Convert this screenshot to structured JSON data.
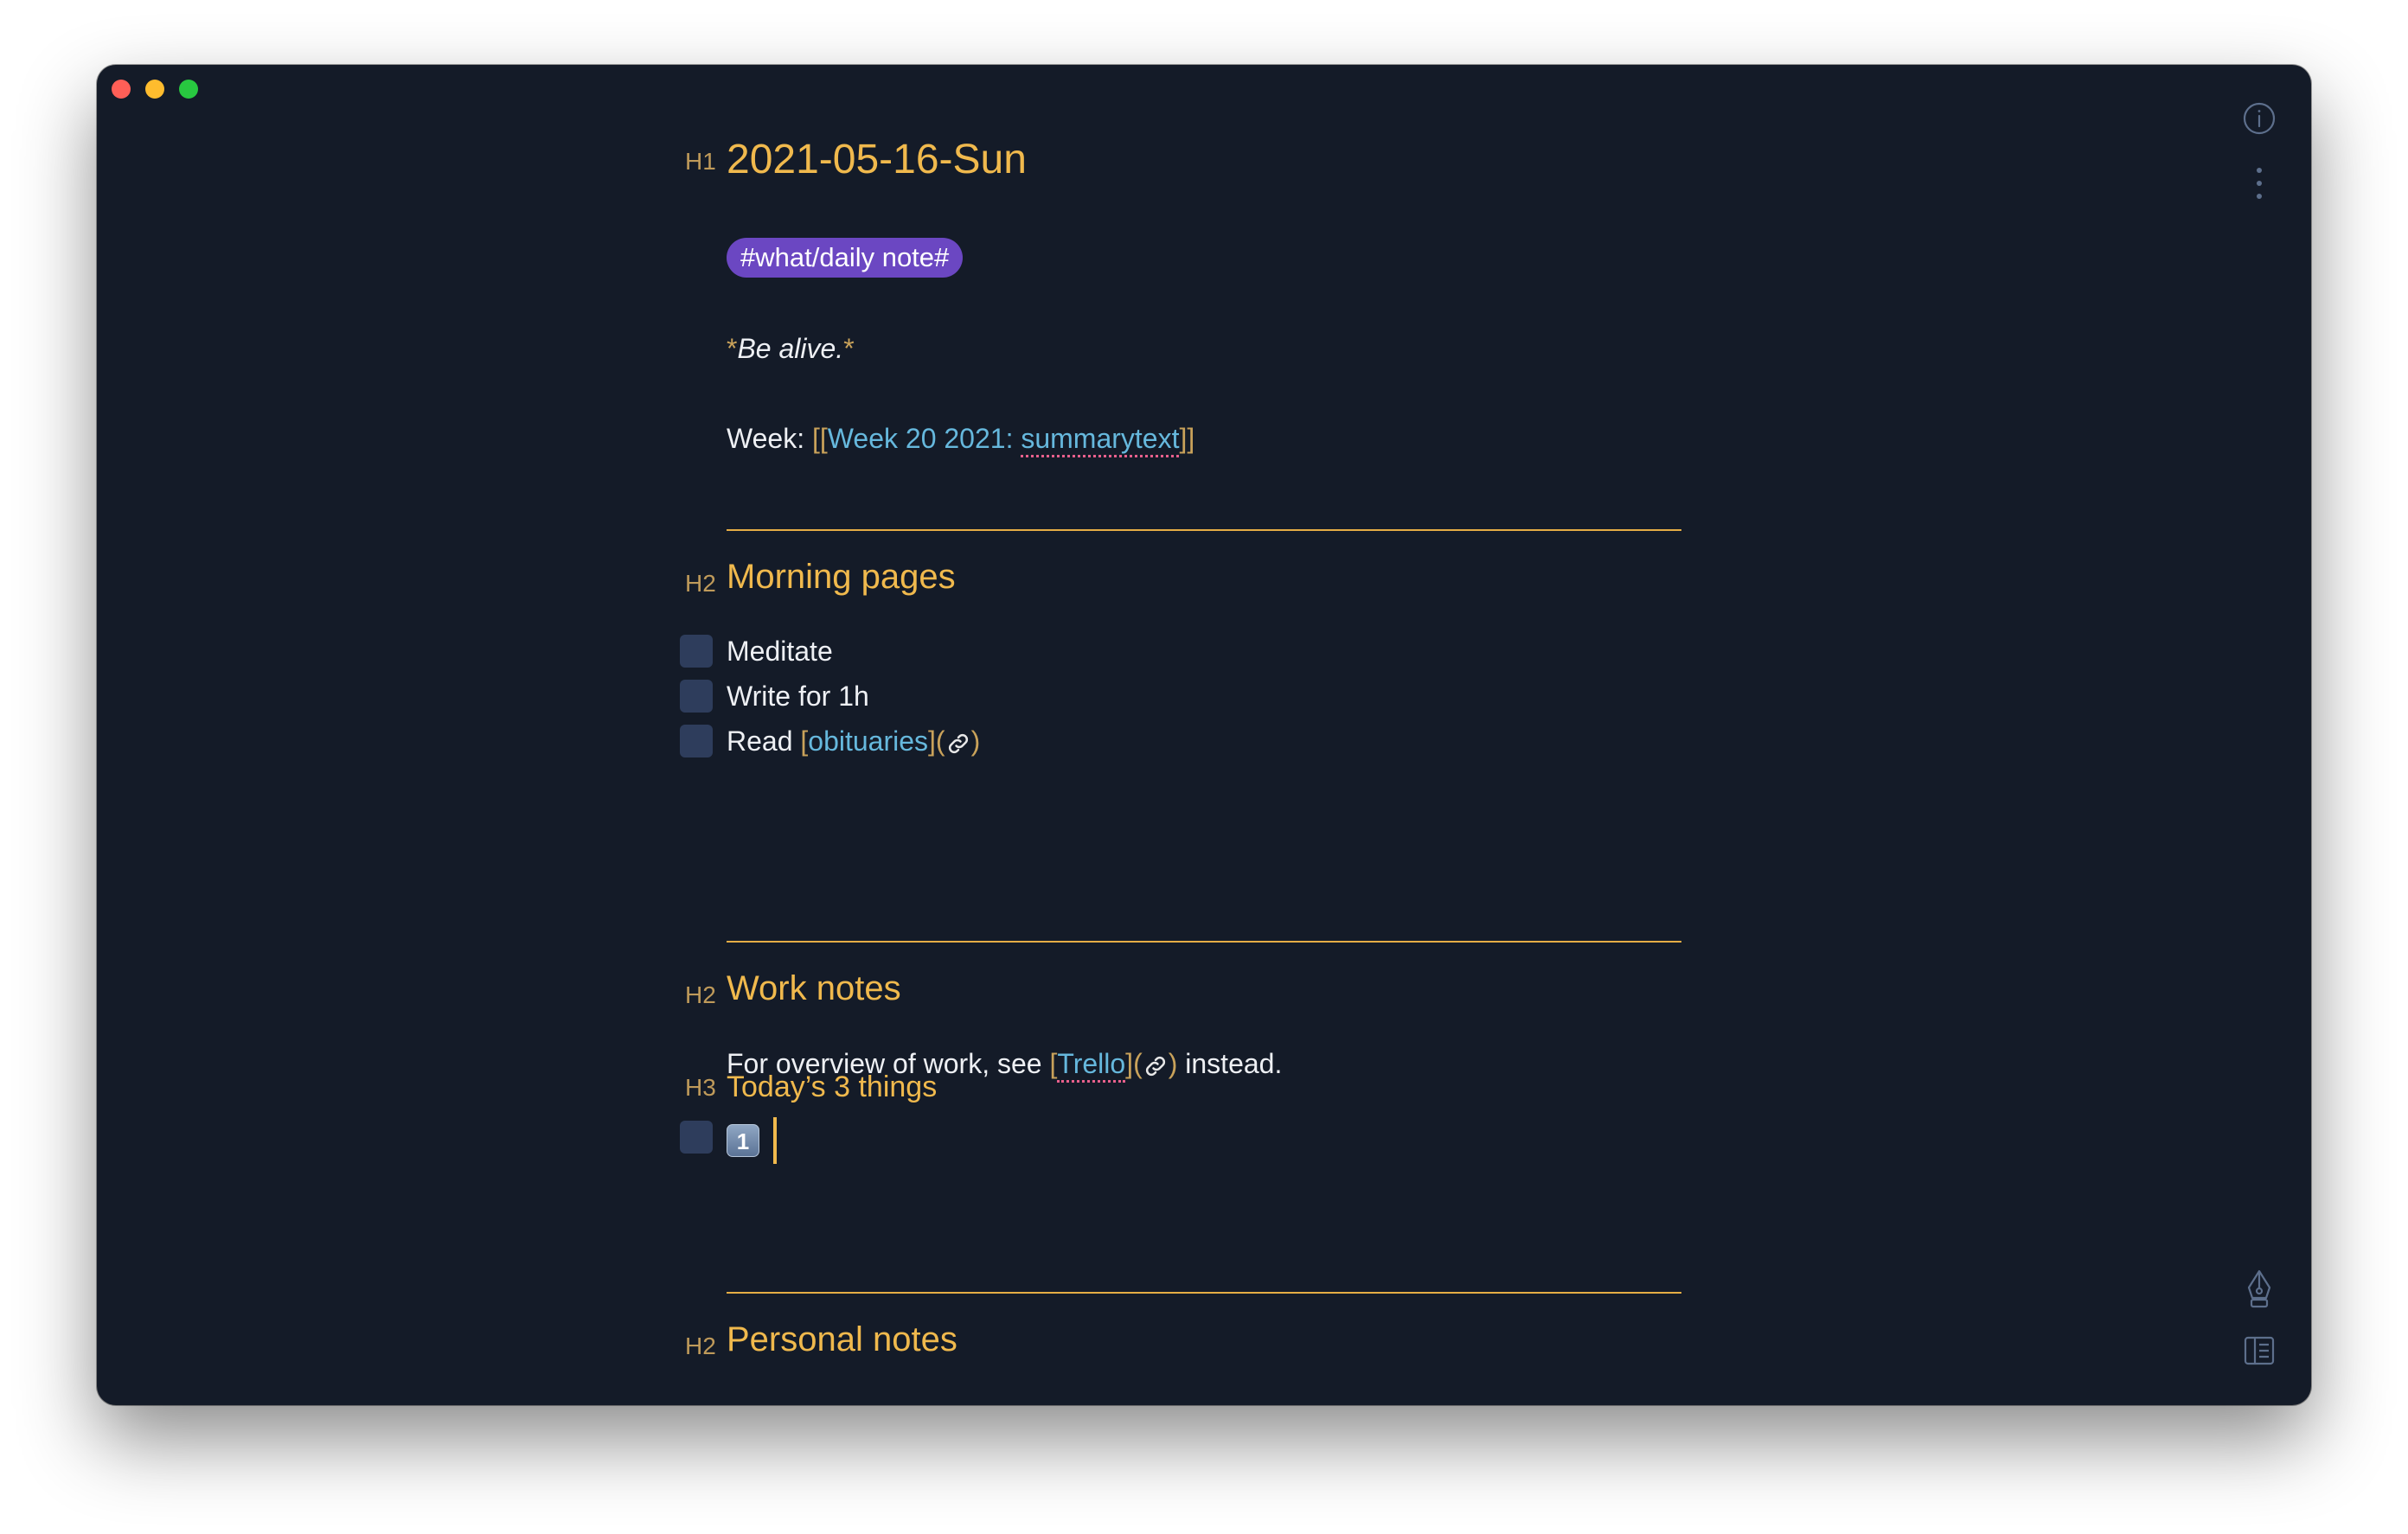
{
  "document": {
    "title_prefix": "H1",
    "title": "2021-05-16-Sun",
    "tag": "#what/daily note#",
    "motto_open": "*",
    "motto": "Be alive.",
    "motto_close": "*",
    "week_label": "Week: ",
    "week_link_open": "[[",
    "week_link_text": "Week 20 2021: ",
    "week_link_misspelled": "summarytext",
    "week_link_close": "]]"
  },
  "morning": {
    "heading_prefix": "H2",
    "heading": "Morning pages",
    "tasks": [
      {
        "label": "Meditate",
        "checked": false
      },
      {
        "label": "Write for 1h",
        "checked": false
      },
      {
        "label": "Read ",
        "checked": false
      }
    ],
    "read_link_open": "[",
    "read_link_text": "obituaries",
    "read_link_mid": "](",
    "read_link_close": ")"
  },
  "work": {
    "heading_prefix": "H2",
    "heading": "Work notes",
    "text_before": "For overview of work, see ",
    "link_open": "[",
    "link_text": "Trello",
    "link_mid": "](",
    "link_close": ")",
    "text_after": " instead."
  },
  "today": {
    "heading_prefix": "H3",
    "heading": "Today’s 3 things",
    "item_emoji": "1"
  },
  "personal": {
    "heading_prefix": "H2",
    "heading": "Personal notes"
  },
  "icons": [
    "info-icon",
    "more-vertical-icon",
    "pen-icon",
    "sidebar-toggle-icon",
    "link-icon"
  ],
  "colors": {
    "background": "#141b28",
    "heading": "#f0b94d",
    "link": "#66b8dd",
    "tag": "#6b47c2",
    "rule": "#e5ad45"
  }
}
